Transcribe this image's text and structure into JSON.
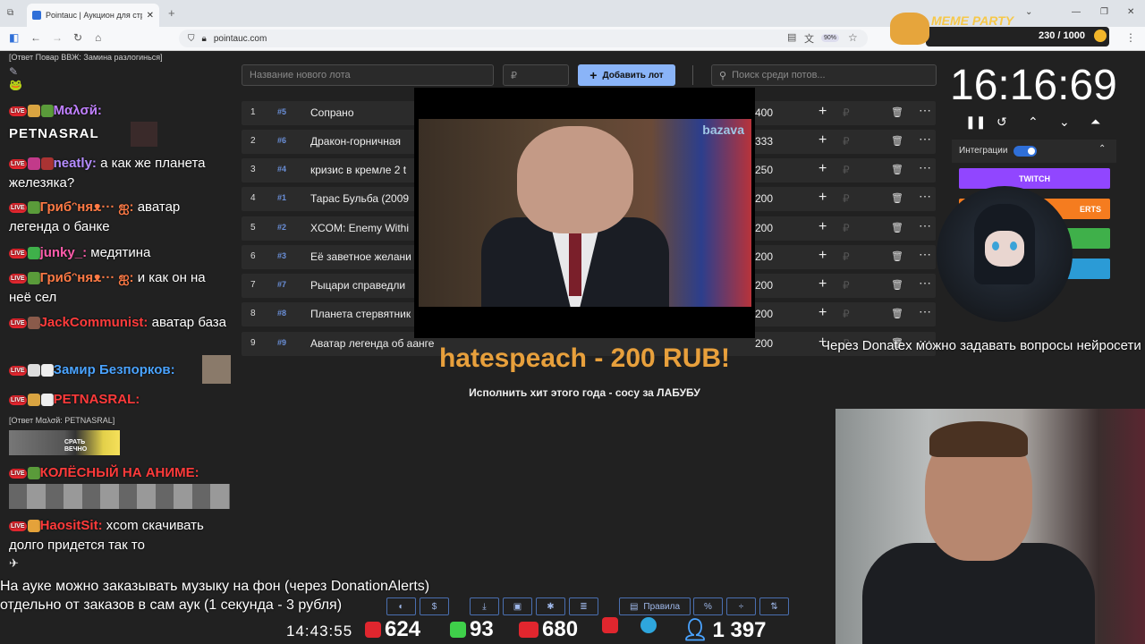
{
  "browser": {
    "tab_title": "Pointauc | Аукцион для стримe",
    "new_tab": "+",
    "url": "pointauc.com",
    "zoom": "90%"
  },
  "auction": {
    "new_lot_placeholder": "Название нового лота",
    "amount_placeholder": "₽",
    "add_button": "Добавить лот",
    "search_placeholder": "Поиск среди потов...",
    "lots": [
      {
        "num": "1",
        "id": "#5",
        "name": "Сопрано",
        "amount": "400"
      },
      {
        "num": "2",
        "id": "#6",
        "name": "Дракон-горничная",
        "amount": "333"
      },
      {
        "num": "3",
        "id": "#4",
        "name": "кризис в кремле 2 t",
        "amount": "250"
      },
      {
        "num": "4",
        "id": "#1",
        "name": "Тарас Бульба (2009",
        "amount": "200"
      },
      {
        "num": "5",
        "id": "#2",
        "name": "XCOM: Enemy Withi",
        "amount": "200"
      },
      {
        "num": "6",
        "id": "#3",
        "name": "Её заветное желани",
        "amount": "200"
      },
      {
        "num": "7",
        "id": "#7",
        "name": "Рыцари справедли",
        "amount": "200"
      },
      {
        "num": "8",
        "id": "#8",
        "name": "Планета стервятник",
        "amount": "200"
      },
      {
        "num": "9",
        "id": "#9",
        "name": "Аватар легенда об аанге",
        "amount": "200"
      }
    ]
  },
  "video": {
    "logo": "bazava"
  },
  "donation": {
    "headline": "hatespeach - 200 RUB!",
    "message": "Исполнить хит этого года - сосу за ЛАБУБУ"
  },
  "timer": {
    "value": "16:16:69"
  },
  "integrations": {
    "label": "Интеграции",
    "twitch": "TWITCH",
    "alerts": "ERTS"
  },
  "meme_party": {
    "title": "MEME PARTY",
    "progress_text": "230 / 1000"
  },
  "chat": {
    "top_reply": "[Ответ Повар ВВЖ: Замина разлогинься]",
    "messages": [
      {
        "nick": "Μαλσй:",
        "text": "",
        "color": "#c080ff"
      },
      {
        "nick": "",
        "text": "PETNASRAL",
        "color": "#ffffff"
      },
      {
        "nick": "neatly:",
        "text": "а как же планета железяка?",
        "color": "#b58cff"
      },
      {
        "nick": "Грибᵔняᴥ··· ஐ:",
        "text": "аватар легенда о банке",
        "color": "#ff7a45"
      },
      {
        "nick": "junky_:",
        "text": "медятина",
        "color": "#ff5cab"
      },
      {
        "nick": "Грибᵔняᴥ··· ஐ:",
        "text": "и как он на неё сел",
        "color": "#ff7a45"
      },
      {
        "nick": "JackCommunist:",
        "text": "аватар база",
        "color": "#ff3b3b"
      },
      {
        "nick": "Замир Безпорков:",
        "text": "",
        "color": "#4aa3ff"
      },
      {
        "nick": "PETNASRAL:",
        "text": "",
        "color": "#ff3b3b"
      },
      {
        "nick": "КОЛЁСНЫЙ НА АНИМЕ:",
        "text": "",
        "color": "#ff3b3b"
      },
      {
        "nick": "HaositSit:",
        "text": "xcom скачивать долго придется так то",
        "color": "#ff3b3b"
      }
    ],
    "reply_small": "[Ответ Μαλσй: PETNASRAL]",
    "emote_text": "СРАТЬ ВЕЧНО"
  },
  "overlay_text": "Через Donatex можно задавать вопросы нейросети",
  "bottom_text_line1": "На ауке можно заказывать музыку на фон (через DonationAlerts)",
  "bottom_text_line2": "отдельно от заказов в сам аук (1 секунда - 3 рубля)",
  "toolbar": {
    "rules": "Правила"
  },
  "stats": {
    "clock": "14:43:55",
    "youtube": "624",
    "kick": "93",
    "live": "680",
    "total": "1 397"
  },
  "colors": {
    "accent": "#8ab4f8",
    "twitch": "#9146ff",
    "alerts": "#f57c1f",
    "donation": "#e8a03c"
  }
}
